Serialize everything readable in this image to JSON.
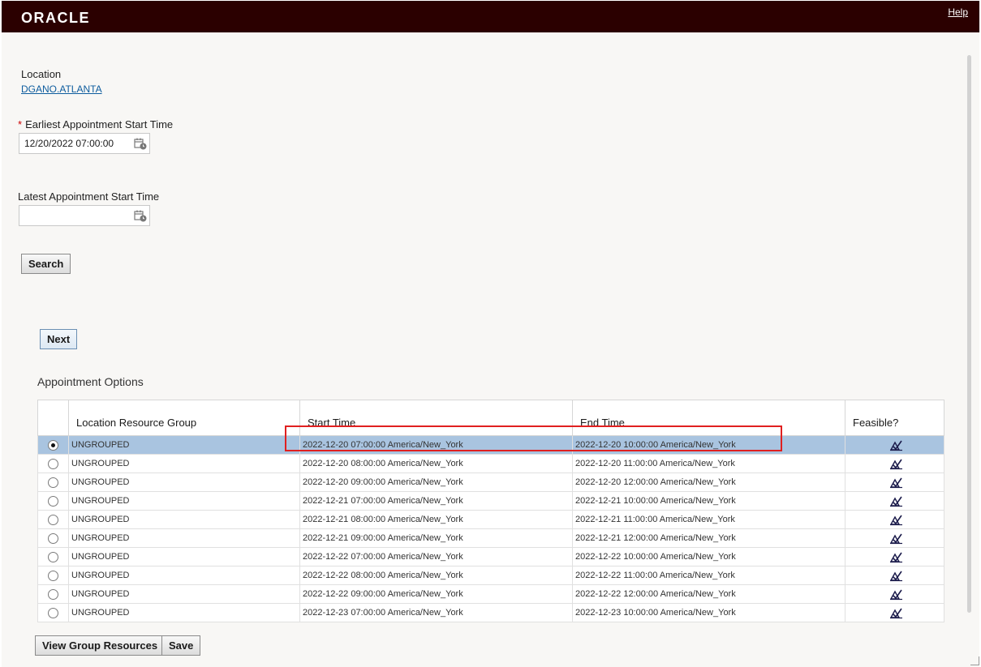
{
  "header": {
    "logo": "ORACLE",
    "help": "Help"
  },
  "location": {
    "label": "Location",
    "value": "DGANO.ATLANTA"
  },
  "earliest": {
    "required_mark": "*",
    "label": "Earliest Appointment Start Time",
    "value": "12/20/2022 07:00:00"
  },
  "latest": {
    "label": "Latest Appointment Start Time",
    "value": ""
  },
  "buttons": {
    "search": "Search",
    "next": "Next",
    "view_group": "View Group Resources",
    "save": "Save"
  },
  "options": {
    "title": "Appointment Options",
    "columns": [
      "",
      "Location Resource Group",
      "Start Time",
      "End Time",
      "Feasible?"
    ],
    "rows": [
      {
        "group": "UNGROUPED",
        "start": "2022-12-20 07:00:00 America/New_York",
        "end": "2022-12-20 10:00:00 America/New_York",
        "selected": true
      },
      {
        "group": "UNGROUPED",
        "start": "2022-12-20 08:00:00 America/New_York",
        "end": "2022-12-20 11:00:00 America/New_York",
        "selected": false
      },
      {
        "group": "UNGROUPED",
        "start": "2022-12-20 09:00:00 America/New_York",
        "end": "2022-12-20 12:00:00 America/New_York",
        "selected": false
      },
      {
        "group": "UNGROUPED",
        "start": "2022-12-21 07:00:00 America/New_York",
        "end": "2022-12-21 10:00:00 America/New_York",
        "selected": false
      },
      {
        "group": "UNGROUPED",
        "start": "2022-12-21 08:00:00 America/New_York",
        "end": "2022-12-21 11:00:00 America/New_York",
        "selected": false
      },
      {
        "group": "UNGROUPED",
        "start": "2022-12-21 09:00:00 America/New_York",
        "end": "2022-12-21 12:00:00 America/New_York",
        "selected": false
      },
      {
        "group": "UNGROUPED",
        "start": "2022-12-22 07:00:00 America/New_York",
        "end": "2022-12-22 10:00:00 America/New_York",
        "selected": false
      },
      {
        "group": "UNGROUPED",
        "start": "2022-12-22 08:00:00 America/New_York",
        "end": "2022-12-22 11:00:00 America/New_York",
        "selected": false
      },
      {
        "group": "UNGROUPED",
        "start": "2022-12-22 09:00:00 America/New_York",
        "end": "2022-12-22 12:00:00 America/New_York",
        "selected": false
      },
      {
        "group": "UNGROUPED",
        "start": "2022-12-23 07:00:00 America/New_York",
        "end": "2022-12-23 10:00:00 America/New_York",
        "selected": false
      }
    ]
  },
  "colors": {
    "header_bg": "#2b0000",
    "selected_row": "#a9c4e0",
    "highlight": "#e02020",
    "link": "#0d5c9e"
  },
  "icons": {
    "calendar": "calendar-clock-icon",
    "feasible": "feasible-check-icon"
  }
}
